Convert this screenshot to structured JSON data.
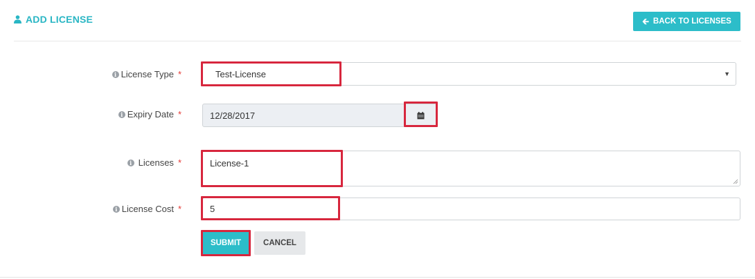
{
  "header": {
    "title": "ADD LICENSE",
    "back_label": "BACK TO LICENSES",
    "accent_color": "#2cbdc9"
  },
  "form": {
    "license_type": {
      "label": "License Type",
      "required": "*",
      "selected": "Test-License"
    },
    "expiry_date": {
      "label": "Expiry Date",
      "required": "*",
      "value": "12/28/2017"
    },
    "licenses": {
      "label": "Licenses",
      "required": "*",
      "value": "License-1"
    },
    "license_cost": {
      "label": "License Cost",
      "required": "*",
      "value": "5"
    }
  },
  "actions": {
    "submit_label": "SUBMIT",
    "cancel_label": "CANCEL"
  },
  "icons": {
    "header": "user-icon",
    "back": "arrow-left-icon",
    "info": "info-icon",
    "calendar": "calendar-icon",
    "dropdown": "caret-down-icon"
  },
  "highlight_color": "#d7263d"
}
